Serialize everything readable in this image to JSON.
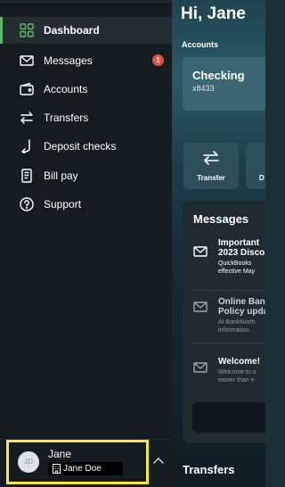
{
  "header": {
    "greeting": "Hi, Jane"
  },
  "accounts": {
    "label": "Accounts",
    "cards": [
      {
        "name": "Checking",
        "number": "x8433"
      }
    ]
  },
  "quick_actions": [
    {
      "label": "Transfer",
      "icon": "transfer-arrows-icon"
    },
    {
      "label": "D",
      "icon": "deposit-icon"
    }
  ],
  "messages": {
    "title": "Messages",
    "items": [
      {
        "title_line1": "Important",
        "title_line2": "2023 Disco",
        "body_line1": "QuickBooks",
        "body_line2": "effective May",
        "read": false
      },
      {
        "title_line1": "Online Bank",
        "title_line2": "Policy upda",
        "body_line1": "At BankNorth",
        "body_line2": "information.",
        "read": true
      },
      {
        "title_line1": "Welcome!",
        "title_line2": "",
        "body_line1": "Welcome to o",
        "body_line2": "easier than e",
        "read": true
      }
    ]
  },
  "transfers": {
    "title": "Transfers"
  },
  "nav": {
    "items": [
      {
        "label": "Dashboard",
        "icon": "dashboard-grid-icon",
        "active": true
      },
      {
        "label": "Messages",
        "icon": "envelope-icon",
        "badge": "1"
      },
      {
        "label": "Accounts",
        "icon": "wallet-icon"
      },
      {
        "label": "Transfers",
        "icon": "transfer-arrows-icon"
      },
      {
        "label": "Deposit checks",
        "icon": "deposit-arrow-icon"
      },
      {
        "label": "Bill pay",
        "icon": "receipt-icon"
      },
      {
        "label": "Support",
        "icon": "help-circle-icon"
      }
    ]
  },
  "profile": {
    "initials": "JD",
    "first_name": "Jane",
    "full_name": "Jane Doe",
    "icon": "building-icon"
  },
  "colors": {
    "accent_green": "#5fb869",
    "badge_red": "#d9573f",
    "highlight_yellow": "#f5ea3a",
    "drawer_bg": "#151b1f"
  }
}
